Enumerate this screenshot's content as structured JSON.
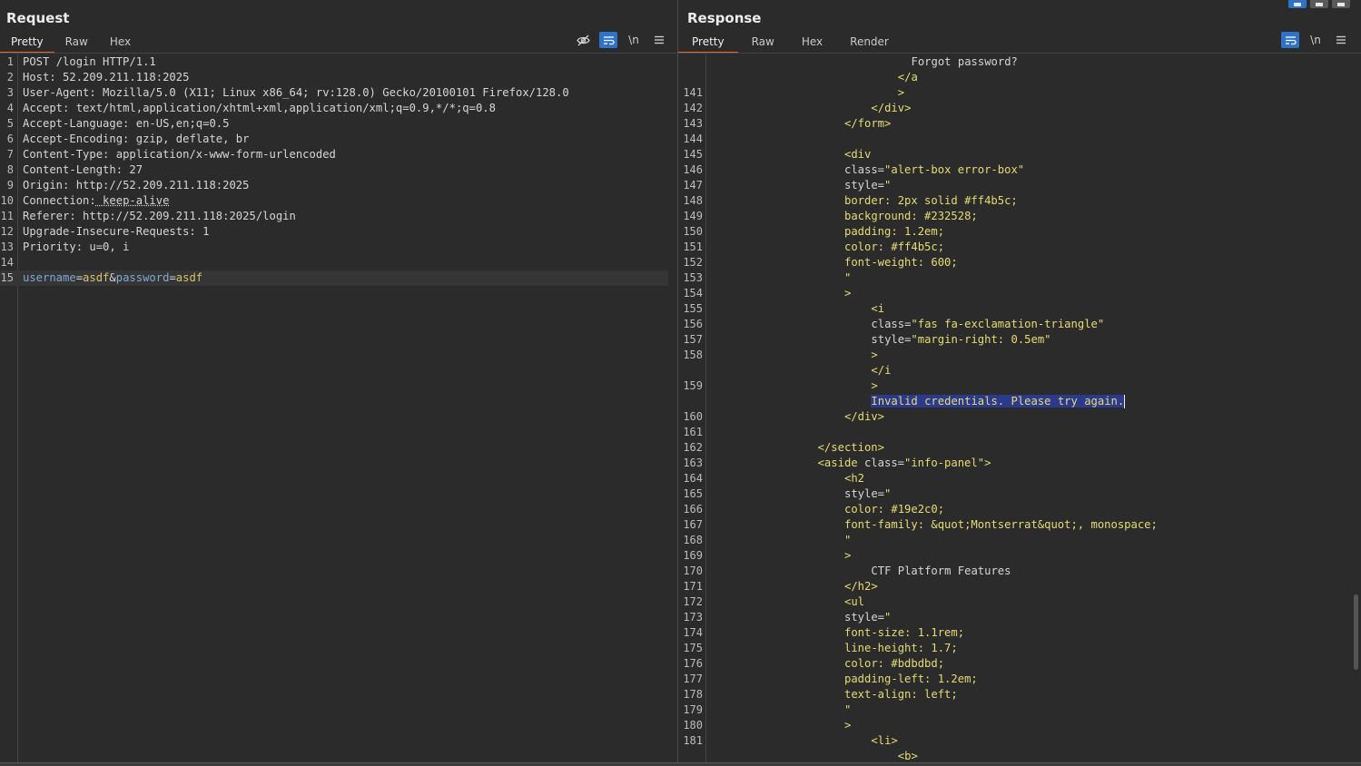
{
  "request": {
    "title": "Request",
    "tabs": [
      {
        "label": "Pretty",
        "active": true
      },
      {
        "label": "Raw",
        "active": false
      },
      {
        "label": "Hex",
        "active": false
      }
    ],
    "toolbar": {
      "hide_icon": "eye-off-icon",
      "wrap_icon": "wrap-icon",
      "newline_label": "\\n",
      "menu_icon": "menu-icon"
    },
    "lines": [
      {
        "n": "1",
        "name": "POST /login HTTP/1.1",
        "value": ""
      },
      {
        "n": "2",
        "name": "Host:",
        "value": " 52.209.211.118:2025"
      },
      {
        "n": "3",
        "name": "User-Agent:",
        "value": " Mozilla/5.0 (X11; Linux x86_64; rv:128.0) Gecko/20100101 Firefox/128.0"
      },
      {
        "n": "4",
        "name": "Accept:",
        "value": " text/html,application/xhtml+xml,application/xml;q=0.9,*/*;q=0.8"
      },
      {
        "n": "5",
        "name": "Accept-Language:",
        "value": " en-US,en;q=0.5"
      },
      {
        "n": "6",
        "name": "Accept-Encoding:",
        "value": " gzip, deflate, br"
      },
      {
        "n": "7",
        "name": "Content-Type:",
        "value": " application/x-www-form-urlencoded"
      },
      {
        "n": "8",
        "name": "Content-Length:",
        "value": " 27"
      },
      {
        "n": "9",
        "name": "Origin:",
        "value": " http://52.209.211.118:2025"
      },
      {
        "n": "10",
        "name": "Connection:",
        "value": " keep-alive"
      },
      {
        "n": "11",
        "name": "Referer:",
        "value": " http://52.209.211.118:2025/login"
      },
      {
        "n": "12",
        "name": "Upgrade-Insecure-Requests:",
        "value": " 1"
      },
      {
        "n": "13",
        "name": "Priority:",
        "value": " u=0, i"
      },
      {
        "n": "14",
        "name": "",
        "value": ""
      }
    ],
    "body_line": {
      "n": "15",
      "p1": "username",
      "eq1": "=",
      "v1": "asdf",
      "amp": "&",
      "p2": "password",
      "eq2": "=",
      "v2": "asdf"
    }
  },
  "response": {
    "title": "Response",
    "tabs": [
      {
        "label": "Pretty",
        "active": true
      },
      {
        "label": "Raw",
        "active": false
      },
      {
        "label": "Hex",
        "active": false
      },
      {
        "label": "Render",
        "active": false
      }
    ],
    "toolbar": {
      "wrap_icon": "wrap-icon",
      "newline_label": "\\n",
      "menu_icon": "menu-icon"
    },
    "corner_buttons": [
      "layout-columns-icon",
      "layout-rows-icon",
      "layout-single-icon"
    ],
    "lines": [
      {
        "n": "",
        "indent": 15,
        "parts": [
          [
            "plain",
            "Forgot password?"
          ]
        ]
      },
      {
        "n": "",
        "indent": 14,
        "parts": [
          [
            "tag",
            "</a"
          ]
        ]
      },
      {
        "n": "141",
        "indent": 14,
        "parts": [
          [
            "tag",
            ">"
          ]
        ]
      },
      {
        "n": "142",
        "indent": 12,
        "parts": [
          [
            "tag",
            "</div>"
          ]
        ]
      },
      {
        "n": "143",
        "indent": 10,
        "parts": [
          [
            "tag",
            "</form>"
          ]
        ]
      },
      {
        "n": "144",
        "indent": 0,
        "parts": []
      },
      {
        "n": "145",
        "indent": 10,
        "parts": [
          [
            "tag",
            "<div"
          ]
        ]
      },
      {
        "n": "146",
        "indent": 10,
        "parts": [
          [
            "attr",
            "class="
          ],
          [
            "str",
            "\"alert-box error-box\""
          ]
        ]
      },
      {
        "n": "147",
        "indent": 10,
        "parts": [
          [
            "attr",
            "style="
          ],
          [
            "str",
            "\""
          ]
        ]
      },
      {
        "n": "148",
        "indent": 10,
        "parts": [
          [
            "str",
            "border: 2px solid #ff4b5c;"
          ]
        ]
      },
      {
        "n": "149",
        "indent": 10,
        "parts": [
          [
            "str",
            "background: #232528;"
          ]
        ]
      },
      {
        "n": "150",
        "indent": 10,
        "parts": [
          [
            "str",
            "padding: 1.2em;"
          ]
        ]
      },
      {
        "n": "151",
        "indent": 10,
        "parts": [
          [
            "str",
            "color: #ff4b5c;"
          ]
        ]
      },
      {
        "n": "152",
        "indent": 10,
        "parts": [
          [
            "str",
            "font-weight: 600;"
          ]
        ]
      },
      {
        "n": "153",
        "indent": 10,
        "parts": [
          [
            "str",
            "\""
          ]
        ]
      },
      {
        "n": "154",
        "indent": 10,
        "parts": [
          [
            "tag",
            ">"
          ]
        ]
      },
      {
        "n": "155",
        "indent": 12,
        "parts": [
          [
            "tag",
            "<i"
          ]
        ]
      },
      {
        "n": "156",
        "indent": 12,
        "parts": [
          [
            "attr",
            "class="
          ],
          [
            "str",
            "\"fas fa-exclamation-triangle\""
          ]
        ]
      },
      {
        "n": "157",
        "indent": 12,
        "parts": [
          [
            "attr",
            "style="
          ],
          [
            "str",
            "\"margin-right: 0.5em\""
          ]
        ]
      },
      {
        "n": "158",
        "indent": 12,
        "parts": [
          [
            "tag",
            ">"
          ]
        ]
      },
      {
        "n": "",
        "indent": 12,
        "parts": [
          [
            "tag",
            "</i"
          ]
        ]
      },
      {
        "n": "159",
        "indent": 12,
        "parts": [
          [
            "tag",
            ">"
          ]
        ]
      },
      {
        "n": "",
        "indent": 12,
        "parts": [
          [
            "sel",
            "Invalid credentials. Please try again."
          ]
        ],
        "caret": true
      },
      {
        "n": "160",
        "indent": 10,
        "parts": [
          [
            "tag",
            "</div>"
          ]
        ]
      },
      {
        "n": "161",
        "indent": 0,
        "parts": []
      },
      {
        "n": "162",
        "indent": 8,
        "parts": [
          [
            "tag",
            "</section>"
          ]
        ]
      },
      {
        "n": "163",
        "indent": 8,
        "parts": [
          [
            "tag",
            "<aside "
          ],
          [
            "attr",
            "class="
          ],
          [
            "str",
            "\"info-panel\""
          ],
          [
            "tag",
            ">"
          ]
        ]
      },
      {
        "n": "164",
        "indent": 10,
        "parts": [
          [
            "tag",
            "<h2"
          ]
        ]
      },
      {
        "n": "165",
        "indent": 10,
        "parts": [
          [
            "attr",
            "style="
          ],
          [
            "str",
            "\""
          ]
        ]
      },
      {
        "n": "166",
        "indent": 10,
        "parts": [
          [
            "str",
            "color: #19e2c0;"
          ]
        ]
      },
      {
        "n": "167",
        "indent": 10,
        "parts": [
          [
            "str",
            "font-family: &quot;Montserrat&quot;, monospace;"
          ]
        ]
      },
      {
        "n": "168",
        "indent": 10,
        "parts": [
          [
            "str",
            "\""
          ]
        ]
      },
      {
        "n": "169",
        "indent": 10,
        "parts": [
          [
            "tag",
            ">"
          ]
        ]
      },
      {
        "n": "170",
        "indent": 12,
        "parts": [
          [
            "plain",
            "CTF Platform Features"
          ]
        ]
      },
      {
        "n": "171",
        "indent": 10,
        "parts": [
          [
            "tag",
            "</h2>"
          ]
        ]
      },
      {
        "n": "172",
        "indent": 10,
        "parts": [
          [
            "tag",
            "<ul"
          ]
        ]
      },
      {
        "n": "173",
        "indent": 10,
        "parts": [
          [
            "attr",
            "style="
          ],
          [
            "str",
            "\""
          ]
        ]
      },
      {
        "n": "174",
        "indent": 10,
        "parts": [
          [
            "str",
            "font-size: 1.1rem;"
          ]
        ]
      },
      {
        "n": "175",
        "indent": 10,
        "parts": [
          [
            "str",
            "line-height: 1.7;"
          ]
        ]
      },
      {
        "n": "176",
        "indent": 10,
        "parts": [
          [
            "str",
            "color: #bdbdbd;"
          ]
        ]
      },
      {
        "n": "177",
        "indent": 10,
        "parts": [
          [
            "str",
            "padding-left: 1.2em;"
          ]
        ]
      },
      {
        "n": "178",
        "indent": 10,
        "parts": [
          [
            "str",
            "text-align: left;"
          ]
        ]
      },
      {
        "n": "179",
        "indent": 10,
        "parts": [
          [
            "str",
            "\""
          ]
        ]
      },
      {
        "n": "180",
        "indent": 10,
        "parts": [
          [
            "tag",
            ">"
          ]
        ]
      },
      {
        "n": "181",
        "indent": 12,
        "parts": [
          [
            "tag",
            "<li>"
          ]
        ]
      },
      {
        "n": "",
        "indent": 14,
        "parts": [
          [
            "tag",
            "<b>"
          ]
        ]
      }
    ]
  }
}
